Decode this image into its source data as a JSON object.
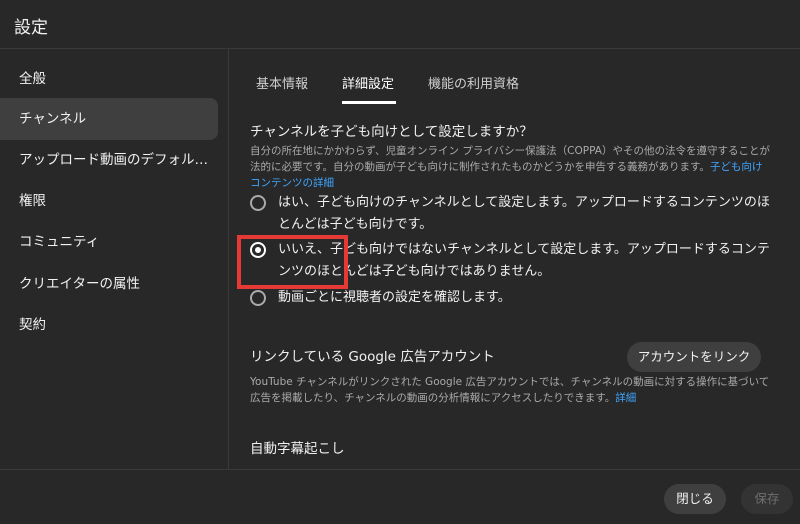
{
  "dialog": {
    "title": "設定"
  },
  "sidebar": {
    "items": [
      {
        "label": "全般"
      },
      {
        "label": "チャンネル",
        "active": true
      },
      {
        "label": "アップロード動画のデフォルト設定"
      },
      {
        "label": "権限"
      },
      {
        "label": "コミュニティ"
      },
      {
        "label": "クリエイターの属性"
      },
      {
        "label": "契約"
      }
    ]
  },
  "tabs": [
    {
      "label": "基本情報"
    },
    {
      "label": "詳細設定",
      "active": true
    },
    {
      "label": "機能の利用資格"
    }
  ],
  "audience": {
    "heading": "チャンネルを子ども向けとして設定しますか？",
    "description": "自分の所在地にかかわらず、児童オンライン プライバシー保護法（COPPA）やその他の法令を遵守することが法的に必要です。自分の動画が子ども向けに制作されたものかどうかを申告する義務があります。",
    "description_link": "子ども向けコンテンツの詳細",
    "options": [
      {
        "label": "はい、子ども向けのチャンネルとして設定します。アップロードするコンテンツのほとんどは子ども向けです。",
        "checked": false
      },
      {
        "label": "いいえ、子ども向けではないチャンネルとして設定します。アップロードするコンテンツのほとんどは子ども向けではありません。",
        "checked": true
      },
      {
        "label": "動画ごとに視聴者の設定を確認します。",
        "checked": false
      }
    ]
  },
  "google_ads": {
    "heading": "リンクしている Google 広告アカウント",
    "button_label": "アカウントをリンク",
    "description": "YouTube チャンネルがリンクされた Google 広告アカウントでは、チャンネルの動画に対する操作に基づいて広告を掲載したり、チャンネルの動画の分析情報にアクセスしたりできます。",
    "description_link": "詳細"
  },
  "captions": {
    "heading": "自動字幕起こし"
  },
  "footer": {
    "close_label": "閉じる",
    "save_label": "保存"
  },
  "colors": {
    "accent_link": "#3ea6ff",
    "highlight": "#e53935",
    "background": "#282828"
  }
}
